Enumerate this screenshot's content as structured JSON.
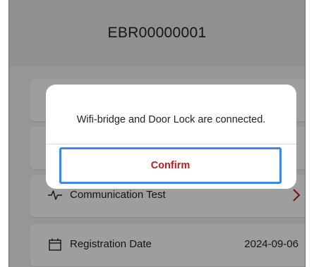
{
  "header": {
    "title": "EBR00000001"
  },
  "rows": [
    {
      "label": "",
      "value": ""
    },
    {
      "label": "",
      "value": ""
    },
    {
      "label": "Communication Test",
      "icon": "pulse-icon",
      "chevron": true
    },
    {
      "label": "Registration Date",
      "icon": "calendar-icon",
      "value": "2024-09-06"
    }
  ],
  "dialog": {
    "message": "Wifi-bridge and Door Lock are connected.",
    "confirm_label": "Confirm"
  },
  "colors": {
    "accent_red": "#c21b1b",
    "focus_blue": "#3d86f2"
  }
}
